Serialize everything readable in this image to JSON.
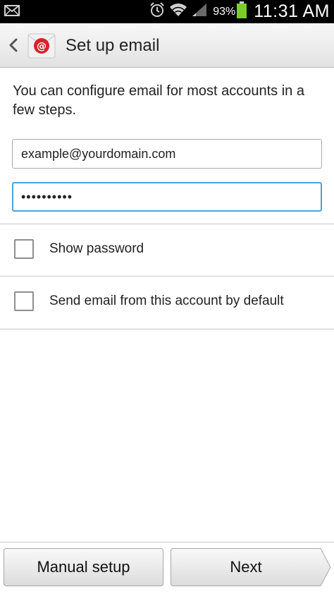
{
  "status_bar": {
    "battery_percent": "93%",
    "time": "11:31 AM",
    "icons": [
      "mail-notification-icon",
      "alarm-icon",
      "wifi-icon",
      "signal-icon",
      "battery-icon"
    ],
    "battery_color": "#7ccd2a"
  },
  "action_bar": {
    "title": "Set up email",
    "back_icon": "chevron-left-icon",
    "app_icon": "email-app-icon",
    "app_icon_color": "#d8232a"
  },
  "form": {
    "intro": "You can configure email for most accounts in a few steps.",
    "email_value": "example@yourdomain.com",
    "password_value": "••••••••••",
    "focus_color": "#4aa3df"
  },
  "options": [
    {
      "label": "Show password",
      "checked": false
    },
    {
      "label": "Send email from this account by default",
      "checked": false
    }
  ],
  "buttons": {
    "manual_setup": "Manual setup",
    "next": "Next"
  }
}
